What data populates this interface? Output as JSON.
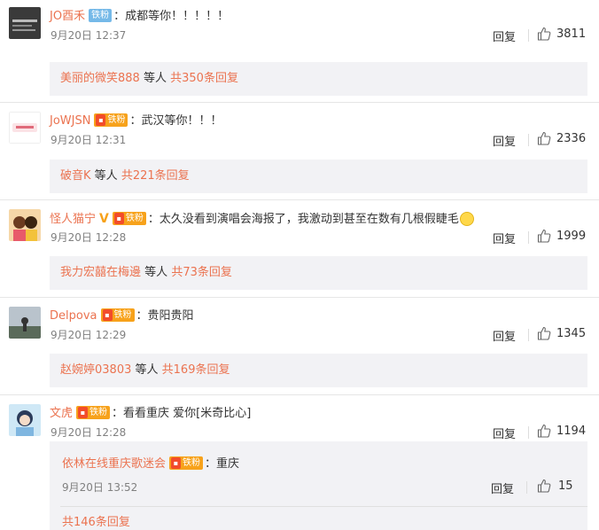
{
  "comments": [
    {
      "username": "JO酉禾",
      "badge": "铁粉",
      "badge_style": "blue",
      "text": "成都等你！！！！！",
      "time": "9月20日 12:37",
      "reply_label": "回复",
      "likes": "3811",
      "sub": {
        "name": "美丽的微笑888",
        "suffix": "等人",
        "count": "共350条回复"
      }
    },
    {
      "username": "JoWJSN",
      "badge": "铁粉",
      "badge_style": "gold",
      "text": "武汉等你！！！",
      "time": "9月20日 12:31",
      "reply_label": "回复",
      "likes": "2336",
      "sub": {
        "name": "破音K",
        "suffix": "等人",
        "count": "共221条回复"
      }
    },
    {
      "username": "怪人猫宁",
      "badge": "铁粉",
      "badge_style": "gold",
      "verified": "V",
      "text": "太久没看到演唱会海报了，我激动到甚至在数有几根假睫毛",
      "time": "9月20日 12:28",
      "reply_label": "回复",
      "likes": "1999",
      "sub": {
        "name": "我力宏囍在梅邊",
        "suffix": "等人",
        "count": "共73条回复"
      }
    },
    {
      "username": "Delpova",
      "badge": "铁粉",
      "badge_style": "gold",
      "text": "贵阳贵阳",
      "time": "9月20日 12:29",
      "reply_label": "回复",
      "likes": "1345",
      "sub": {
        "name": "赵婉婷03803",
        "suffix": "等人",
        "count": "共169条回复"
      }
    },
    {
      "username": "文虎",
      "badge": "铁粉",
      "badge_style": "gold",
      "text": "看看重庆 爱你[米奇比心]",
      "time": "9月20日 12:28",
      "reply_label": "回复",
      "likes": "1194"
    }
  ],
  "nested_reply": {
    "username": "依林在线重庆歌迷会",
    "badge": "铁粉",
    "text": "重庆",
    "time": "9月20日 13:52",
    "reply_label": "回复",
    "likes": "15",
    "all_replies": "共146条回复"
  },
  "colors": {
    "accent": "#eb7350",
    "badge_gold": "#f7a21b",
    "badge_blue": "#75b9e8",
    "panel": "#f2f2f5"
  }
}
